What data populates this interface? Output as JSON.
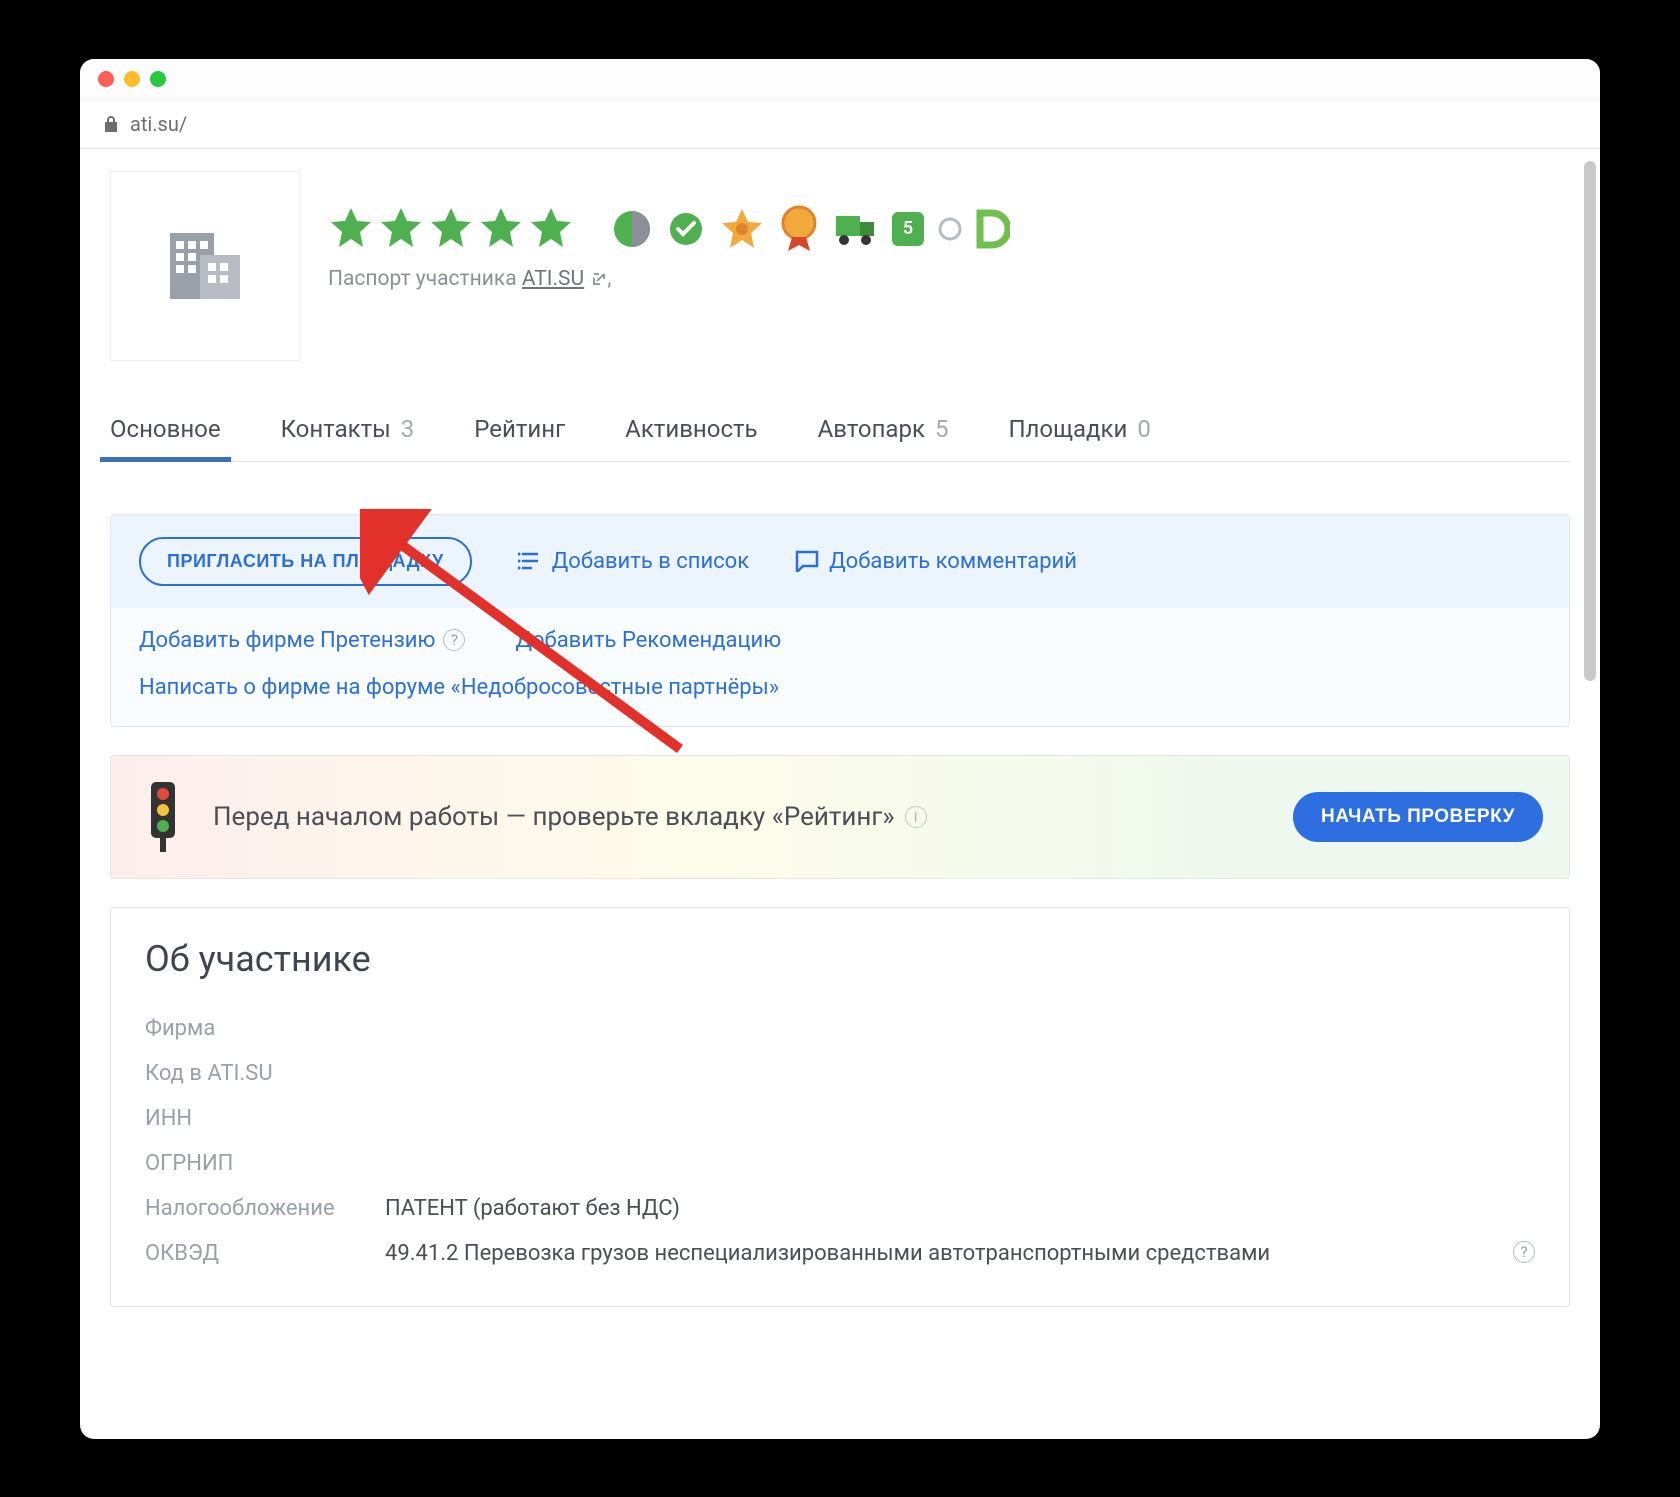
{
  "address_bar": {
    "url": "ati.su/"
  },
  "header": {
    "passport_prefix": "Паспорт участника ",
    "passport_linktext": "ATI.SU",
    "passport_suffix": ",",
    "stars": 5,
    "badge_truck_num": "5"
  },
  "tabs": [
    {
      "label": "Основное",
      "count": "",
      "active": true
    },
    {
      "label": "Контакты",
      "count": "3",
      "active": false
    },
    {
      "label": "Рейтинг",
      "count": "",
      "active": false
    },
    {
      "label": "Активность",
      "count": "",
      "active": false
    },
    {
      "label": "Автопарк",
      "count": "5",
      "active": false
    },
    {
      "label": "Площадки",
      "count": "0",
      "active": false
    }
  ],
  "actions": {
    "invite_btn": "ПРИГЛАСИТЬ НА ПЛОЩАДКУ",
    "add_list": "Добавить в список",
    "add_comment": "Добавить комментарий",
    "add_claim": "Добавить фирме Претензию",
    "add_rec": "Добавить Рекомендацию",
    "forum_link": "Написать о фирме на форуме «Недобросовестные партнёры»"
  },
  "banner": {
    "text": "Перед началом работы — проверьте вкладку «Рейтинг»",
    "button": "НАЧАТЬ ПРОВЕРКУ"
  },
  "about": {
    "title": "Об участнике",
    "fields": [
      {
        "label": "Фирма",
        "value": ""
      },
      {
        "label": "Код в ATI.SU",
        "value": ""
      },
      {
        "label": "ИНН",
        "value": ""
      },
      {
        "label": "ОГРНИП",
        "value": ""
      },
      {
        "label": "Налогообложение",
        "value": "ПАТЕНТ (работают без НДС)"
      },
      {
        "label": "ОКВЭД",
        "value": "49.41.2 Перевозка грузов неспециализированными автотранспортными средствами",
        "help": true
      }
    ]
  }
}
